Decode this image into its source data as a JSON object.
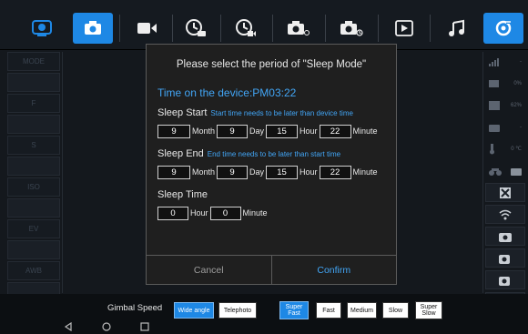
{
  "toolbar": {
    "icons": [
      "logo-icon",
      "camera-icon",
      "video-icon",
      "timelapse-photo-icon",
      "timelapse-video-icon",
      "burst-photo-icon",
      "timer-photo-icon",
      "playback-icon",
      "music-icon",
      "settings-icon"
    ],
    "active_color": "#1e88e5"
  },
  "left_menu": {
    "items": [
      "MODE",
      "",
      "F",
      "",
      "S",
      "",
      "ISO",
      "",
      "EV",
      "",
      "AWB",
      ""
    ]
  },
  "right_status": {
    "signal": "-",
    "battery": "0%",
    "storage": "62%",
    "camera_value": "-",
    "temperature": "0 ℃"
  },
  "dialog": {
    "title": "Please select the period of \"Sleep Mode\"",
    "device_time": "Time on the device:PM03:22",
    "sleep_start": {
      "label": "Sleep Start",
      "hint": "Start time needs to be later than device time",
      "month": "9",
      "day": "9",
      "hour": "15",
      "minute": "22"
    },
    "sleep_end": {
      "label": "Sleep End",
      "hint": "End time needs to be later than start time",
      "month": "9",
      "day": "9",
      "hour": "15",
      "minute": "22"
    },
    "sleep_time": {
      "label": "Sleep Time",
      "hour": "0",
      "minute": "0"
    },
    "units": {
      "month": "Month",
      "day": "Day",
      "hour": "Hour",
      "minute": "Minute"
    },
    "cancel_label": "Cancel",
    "confirm_label": "Confirm",
    "accent_color": "#42a5f5"
  },
  "bottom": {
    "gimbal_label": "Gimbal Speed",
    "wide_angle": "Wide angle",
    "telephoto": "Telephoto",
    "super_fast": "Super\nFast",
    "fast": "Fast",
    "medium": "Medium",
    "slow": "Slow",
    "super_slow": "Super\nSlow"
  }
}
